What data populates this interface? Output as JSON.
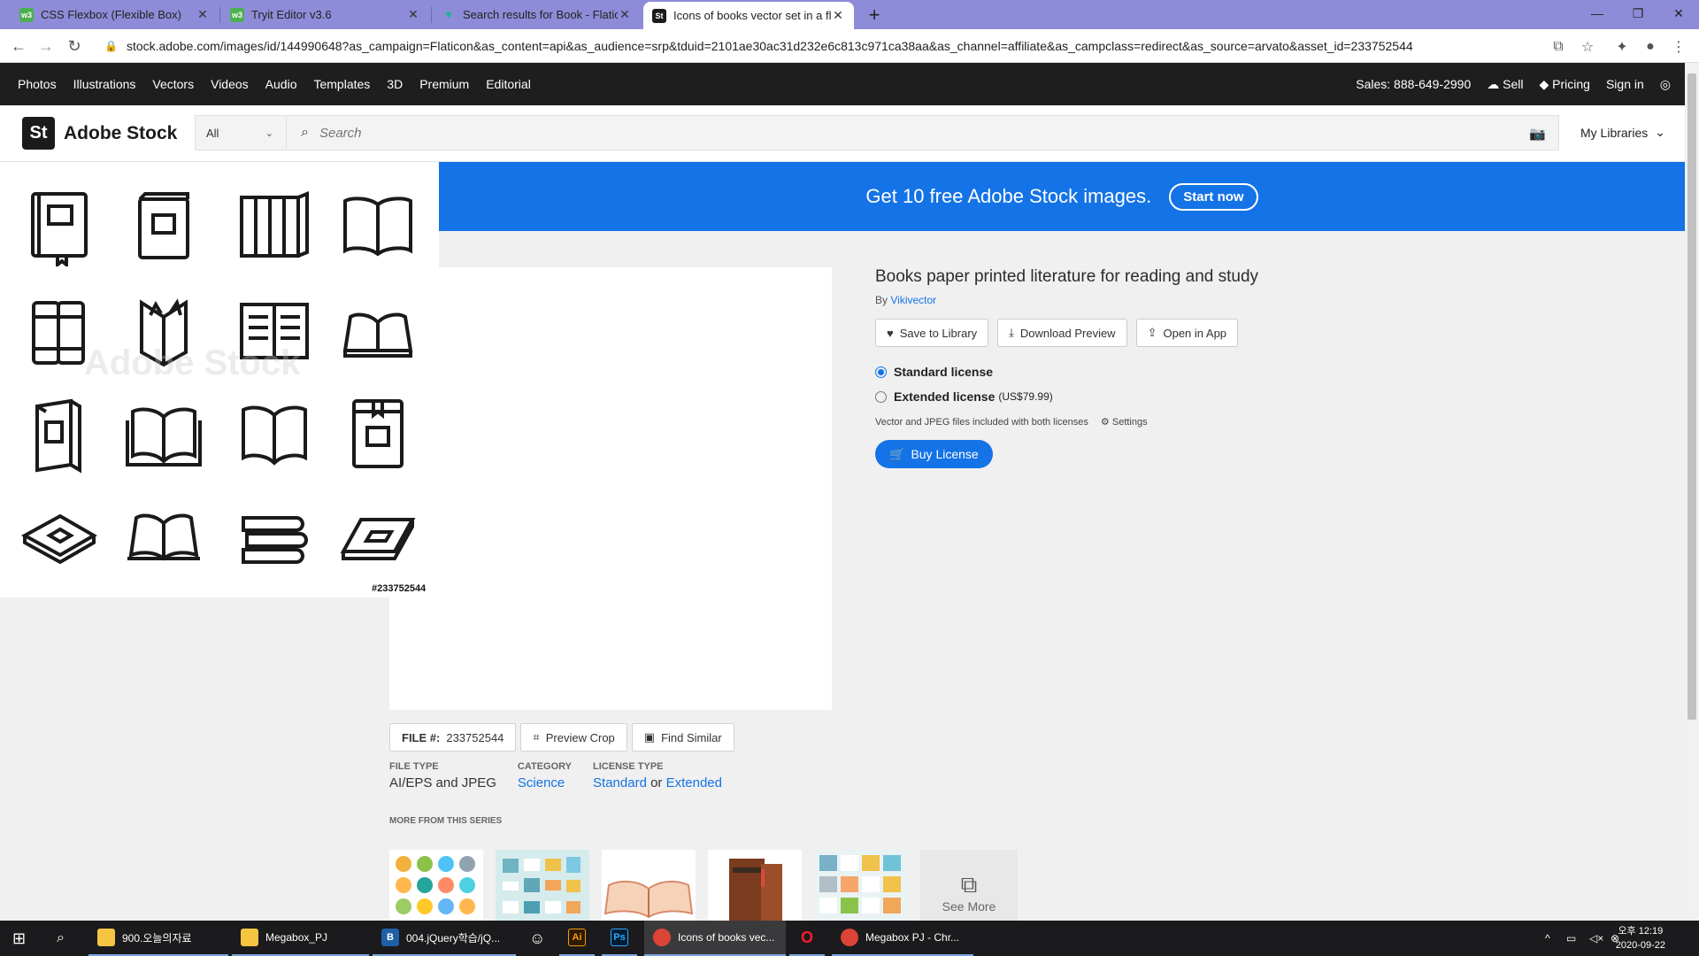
{
  "browser": {
    "tabs": [
      {
        "title": "CSS Flexbox (Flexible Box)",
        "favicon": "w3"
      },
      {
        "title": "Tryit Editor v3.6",
        "favicon": "w3"
      },
      {
        "title": "Search results for Book - Flatico",
        "favicon": "flaticon"
      },
      {
        "title": "Icons of books vector set in a fl",
        "favicon": "St"
      }
    ],
    "new_tab": "+",
    "url": "stock.adobe.com/images/id/144990648?as_campaign=Flaticon&as_content=api&as_audience=srp&tduid=2101ae30ac31d232e6c813c971ca38aa&as_channel=affiliate&as_campclass=redirect&as_source=arvato&asset_id=233752544"
  },
  "topnav": {
    "items": [
      "Photos",
      "Illustrations",
      "Vectors",
      "Videos",
      "Audio",
      "Templates",
      "3D",
      "Premium",
      "Editorial"
    ],
    "sales": "Sales: 888-649-2990",
    "sell": "Sell",
    "pricing": "Pricing",
    "signin": "Sign in"
  },
  "header": {
    "logo_mark": "St",
    "logo_text": "Adobe Stock",
    "scope": "All",
    "search_placeholder": "Search",
    "my_libraries": "My Libraries"
  },
  "banner": {
    "text": "Get 10 free Adobe Stock images.",
    "button": "Start now",
    "color": "#1473e6"
  },
  "preview": {
    "watermark": "Adobe Stock",
    "asset_id": "#233752544"
  },
  "details": {
    "title": "Books paper printed literature for reading and study",
    "by_prefix": "By",
    "author": "Vikivector",
    "save": "Save to Library",
    "download": "Download Preview",
    "open": "Open in App",
    "standard_license": "Standard license",
    "extended_license": "Extended license",
    "extended_price": "(US$79.99)",
    "license_note": "Vector and JPEG files included with both licenses",
    "settings": "Settings",
    "buy": "Buy License"
  },
  "file": {
    "file_label": "FILE #:",
    "file_number": "233752544",
    "preview_crop": "Preview Crop",
    "find_similar": "Find Similar",
    "file_type_label": "FILE TYPE",
    "file_type": "AI/EPS and JPEG",
    "category_label": "CATEGORY",
    "category": "Science",
    "license_type_label": "LICENSE TYPE",
    "license_standard": "Standard",
    "license_or": "or",
    "license_extended": "Extended",
    "more_series": "MORE FROM THIS SERIES",
    "see_more": "See More"
  },
  "taskbar": {
    "items": [
      {
        "label": "900.오늘의자료"
      },
      {
        "label": "Megabox_PJ"
      },
      {
        "label": "004.jQuery학습/jQ..."
      },
      {
        "label": "Icons of books vec..."
      },
      {
        "label": "Megabox PJ - Chr..."
      }
    ],
    "time": "오후 12:19",
    "date": "2020-09-22"
  }
}
